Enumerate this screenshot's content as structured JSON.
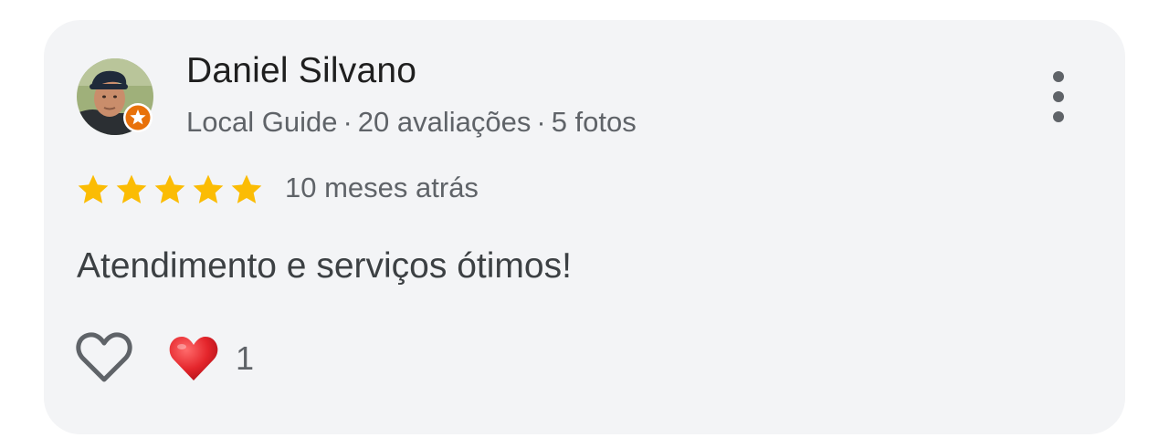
{
  "review": {
    "author_name": "Daniel Silvano",
    "author_role": "Local Guide",
    "separator": "·",
    "review_count": "20 avaliações",
    "photo_count": "5 fotos",
    "rating": 5,
    "rating_max": 5,
    "time_ago": "10 meses atrás",
    "text": "Atendimento e serviços ótimos!",
    "reaction_count": "1"
  },
  "icons": {
    "more": "more-vert-icon",
    "like": "heart-outline-icon",
    "reaction": "red-heart-emoji-icon",
    "star": "star-icon",
    "badge": "local-guide-badge-icon"
  },
  "colors": {
    "card_background": "#f3f4f6",
    "star": "#fbbc04",
    "badge": "#e8710a",
    "reaction_heart": "#e4252b"
  }
}
